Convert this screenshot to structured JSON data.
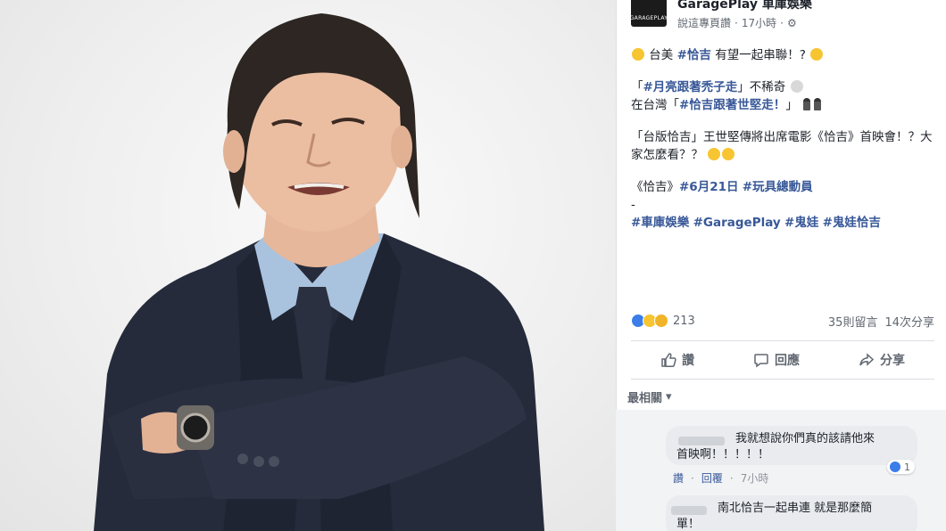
{
  "post": {
    "page_name": "GaragePlay 車庫娛樂",
    "logo_text": "GARAGEPLAY",
    "meta_prefix": "說這專頁讚",
    "time": "17小時",
    "separator": "·",
    "line1_prefix": "台美",
    "line1_tag": "#恰吉",
    "line1_suffix": "有望一起串聯！?",
    "line2_open": "「",
    "line2_tag": "#月亮跟著禿子走",
    "line2_suffix": "」不稀奇",
    "line3_prefix": "在台灣「",
    "line3_tag": "#恰吉跟著世堅走！",
    "line3_suffix": "」",
    "para3": "「台版恰吉」王世堅傳將出席電影《恰吉》首映會！？大家怎麼看？？",
    "line5_prefix": "《恰吉》",
    "line5_tag1": "#6月21日",
    "line5_tag2": "#玩具總動員",
    "dash": "-",
    "hashtags": [
      "#車庫娛樂",
      "#GaragePlay",
      "#鬼娃",
      "#鬼娃恰吉"
    ]
  },
  "reactions": {
    "count": "213",
    "comments": "35則留言",
    "shares": "14次分享"
  },
  "actions": {
    "like": "讚",
    "comment": "回應",
    "share": "分享"
  },
  "sort": {
    "label": "最相關"
  },
  "comments": [
    {
      "text_line1": "我就想說你們真的該請他來",
      "text_line2": "首映啊！！！！！",
      "reaction_count": "1",
      "like_link": "讚",
      "reply_link": "回覆",
      "time": "7小時"
    },
    {
      "text_line1": "南北恰吉一起串連 就是那麼簡",
      "text_line2": "單！"
    }
  ],
  "colors": {
    "link": "#385898",
    "like_blue": "#3b7de9",
    "suit": "#252a3a"
  },
  "icons": [
    "gear-icon",
    "like-icon",
    "comment-icon",
    "share-icon",
    "chevron-down-icon",
    "watch-icon"
  ]
}
